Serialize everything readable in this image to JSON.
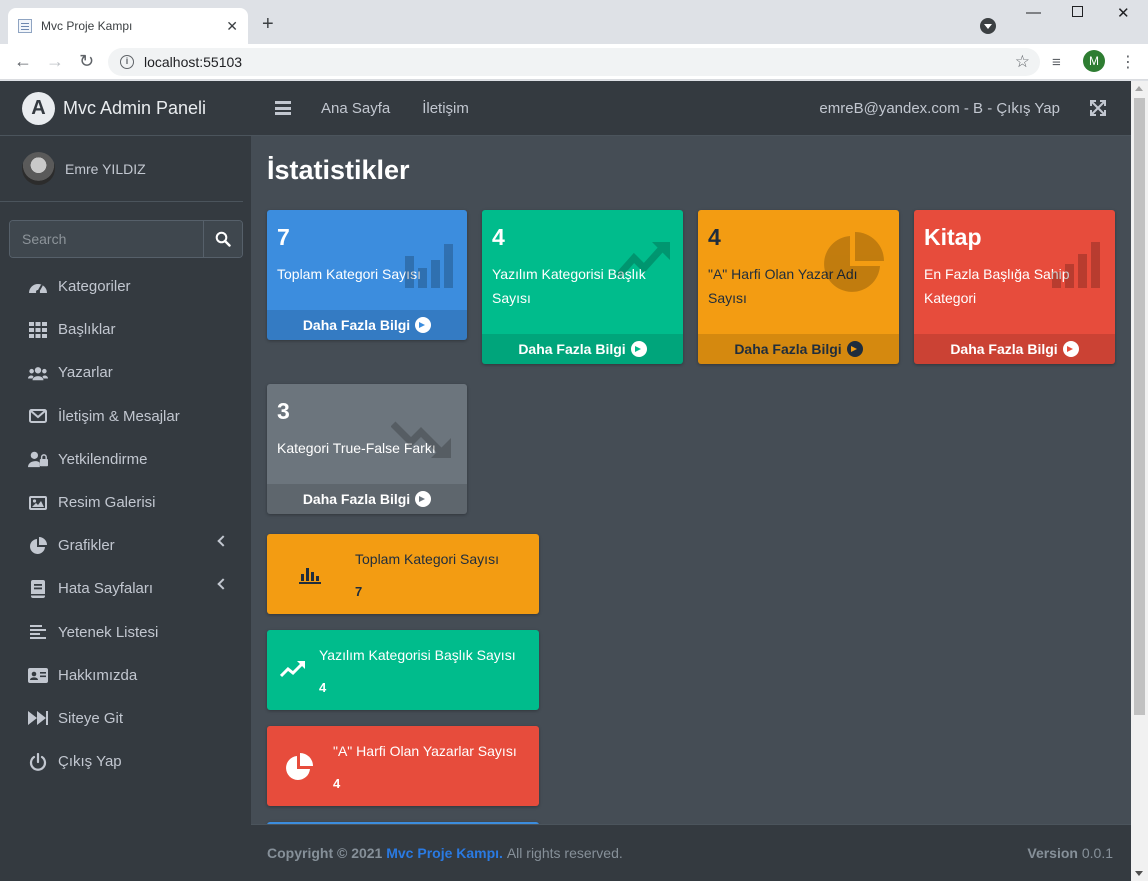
{
  "browser": {
    "tab_title": "Mvc Proje Kampı",
    "url": "localhost:55103",
    "profile_initial": "M"
  },
  "sidebar": {
    "brand": "Mvc Admin Paneli",
    "user_name": "Emre YILDIZ",
    "search_placeholder": "Search",
    "items": [
      {
        "label": "Kategoriler",
        "icon": "tachometer-icon"
      },
      {
        "label": "Başlıklar",
        "icon": "grid-icon"
      },
      {
        "label": "Yazarlar",
        "icon": "users-icon"
      },
      {
        "label": "İletişim & Mesajlar",
        "icon": "envelope-icon"
      },
      {
        "label": "Yetkilendirme",
        "icon": "user-lock-icon"
      },
      {
        "label": "Resim Galerisi",
        "icon": "image-icon"
      },
      {
        "label": "Grafikler",
        "icon": "pie-chart-icon"
      },
      {
        "label": "Hata Sayfaları",
        "icon": "book-icon"
      },
      {
        "label": "Yetenek Listesi",
        "icon": "list-icon"
      },
      {
        "label": "Hakkımızda",
        "icon": "id-card-icon"
      },
      {
        "label": "Siteye Git",
        "icon": "fast-forward-icon"
      },
      {
        "label": "Çıkış Yap",
        "icon": "power-icon"
      }
    ]
  },
  "topnav": {
    "home": "Ana Sayfa",
    "contact": "İletişim",
    "user_link": "emreB@yandex.com - B - Çıkış Yap"
  },
  "main": {
    "title": "İstatistikler",
    "more_info": "Daha Fazla Bilgi",
    "small_boxes": [
      {
        "value": "7",
        "label": "Toplam Kategori Sayısı",
        "color": "#3c8dde",
        "icon": "bar-chart-icon"
      },
      {
        "value": "4",
        "label": "Yazılım Kategorisi Başlık Sayısı",
        "color": "#00bc8c",
        "icon": "trend-up-icon"
      },
      {
        "value": "4",
        "label": "\"A\" Harfi Olan Yazar Adı Sayısı",
        "color": "#f39c12",
        "icon": "pie-chart-icon"
      },
      {
        "value": "Kitap",
        "label": "En Fazla Başlığa Sahip Kategori",
        "color": "#e74c3c",
        "icon": "bar-chart-icon"
      },
      {
        "value": "3",
        "label": "Kategori True-False Farkı",
        "color": "#6c757d",
        "icon": "trend-down-icon"
      }
    ],
    "info_boxes": [
      {
        "title": "Toplam Kategori Sayısı",
        "value": "7",
        "color": "#f39c12",
        "icon": "bar-chart-icon"
      },
      {
        "title": "Yazılım Kategorisi Başlık Sayısı",
        "value": "4",
        "color": "#00bc8c",
        "icon": "trend-up-icon"
      },
      {
        "title": "\"A\" Harfi Olan Yazarlar Sayısı",
        "value": "4",
        "color": "#e74c3c",
        "icon": "pie-chart-icon"
      }
    ]
  },
  "footer": {
    "copyright": "Copyright © 2021",
    "brand": "Mvc Proje Kampı.",
    "rights": "All rights reserved.",
    "version_label": "Version",
    "version_number": "0.0.1"
  }
}
